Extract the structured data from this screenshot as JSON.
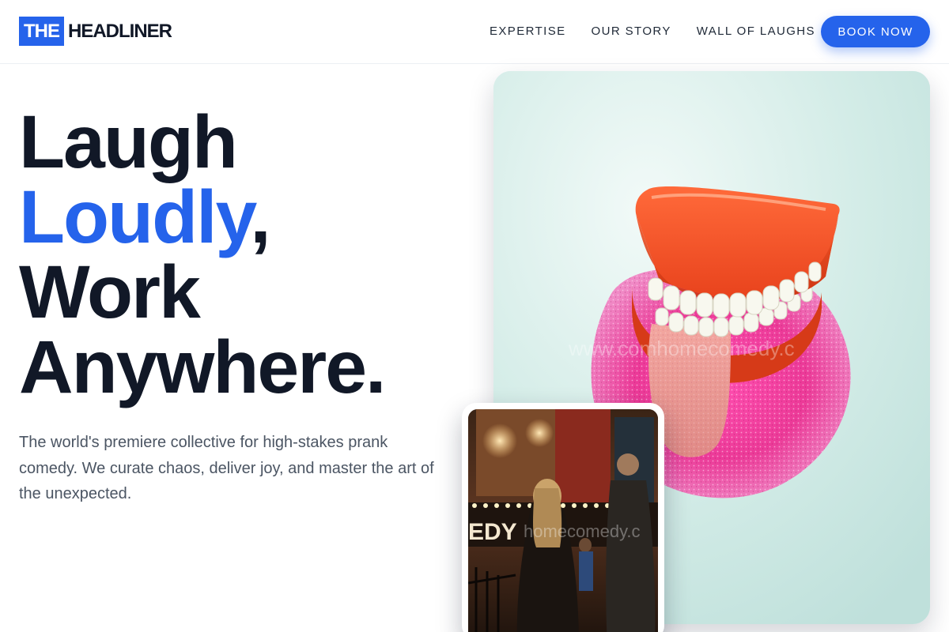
{
  "brand": {
    "logo_box_text": "THE",
    "logo_text": "HEADLINER",
    "accent_color": "#2563eb",
    "text_color": "#111827"
  },
  "nav": {
    "items": [
      {
        "label": "EXPERTISE"
      },
      {
        "label": "OUR STORY"
      },
      {
        "label": "WALL OF LAUGHS"
      }
    ],
    "cta_label": "BOOK NOW"
  },
  "hero": {
    "line1": "Laugh",
    "line2_accent": "Loudly",
    "line2_rest": ",",
    "line3": "Work",
    "line4": "Anywhere.",
    "description": "The world's premiere collective for high-stakes prank comedy. We curate chaos, deliver joy, and master the art of the unexpected."
  },
  "images": {
    "main": {
      "subject": "wind-up chattering teeth toy with tongue on pink fuzzy pad",
      "watermark": "www.comhomecomedy.c"
    },
    "secondary": {
      "subject": "people in line outside a comedy club at night",
      "sign_text": "EDY",
      "watermark": "homecomedy.c"
    }
  }
}
